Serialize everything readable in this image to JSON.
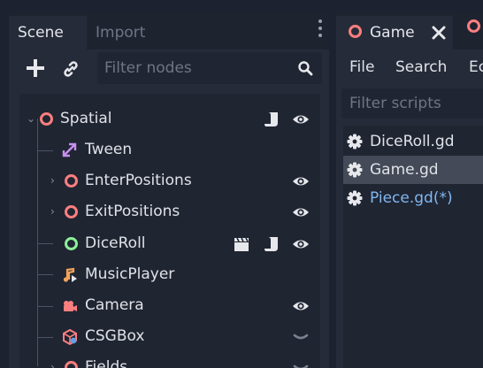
{
  "left_dock": {
    "tabs": [
      {
        "label": "Scene",
        "active": true
      },
      {
        "label": "Import",
        "active": false
      }
    ],
    "toolbar": {
      "add_icon": "plus-icon",
      "link_icon": "link-icon",
      "filter_placeholder": "Filter nodes",
      "search_icon": "search-icon"
    },
    "tree": [
      {
        "label": "Spatial",
        "icon": "spatial-node-icon",
        "expanded": true,
        "depth": 0,
        "right_icons": [
          "script-icon",
          "visibility-icon"
        ]
      },
      {
        "label": "Tween",
        "icon": "tween-icon",
        "depth": 1,
        "right_icons": []
      },
      {
        "label": "EnterPositions",
        "icon": "spatial-node-icon",
        "collapsed": true,
        "depth": 1,
        "right_icons": [
          "visibility-icon"
        ]
      },
      {
        "label": "ExitPositions",
        "icon": "spatial-node-icon",
        "collapsed": true,
        "depth": 1,
        "right_icons": [
          "visibility-icon"
        ]
      },
      {
        "label": "DiceRoll",
        "icon": "control-node-icon",
        "depth": 1,
        "right_icons": [
          "clapper-icon",
          "script-icon",
          "visibility-icon"
        ]
      },
      {
        "label": "MusicPlayer",
        "icon": "audio-player-icon",
        "depth": 1,
        "right_icons": []
      },
      {
        "label": "Camera",
        "icon": "camera-icon",
        "depth": 1,
        "right_icons": [
          "visibility-icon"
        ]
      },
      {
        "label": "CSGBox",
        "icon": "csg-box-icon",
        "depth": 1,
        "right_icons": [
          "chevron-down-icon"
        ]
      },
      {
        "label": "Fields",
        "icon": "spatial-node-icon",
        "collapsed": true,
        "depth": 1,
        "right_icons": [
          "chevron-down-icon"
        ]
      }
    ]
  },
  "right_dock": {
    "tabs": [
      {
        "label": "Game",
        "active": true,
        "closable": true
      }
    ],
    "menu": [
      "File",
      "Search",
      "Ec"
    ],
    "filter_placeholder": "Filter scripts",
    "scripts": [
      {
        "name": "DiceRoll.gd",
        "selected": false,
        "modified": false
      },
      {
        "name": "Game.gd",
        "selected": true,
        "modified": false
      },
      {
        "name": "Piece.gd(*)",
        "selected": false,
        "modified": true
      }
    ]
  },
  "colors": {
    "spatial_ring": "#fc7f7f",
    "control_ring": "#8eef97",
    "modified_script": "#80b7f0",
    "selected_row": "#444a57"
  }
}
